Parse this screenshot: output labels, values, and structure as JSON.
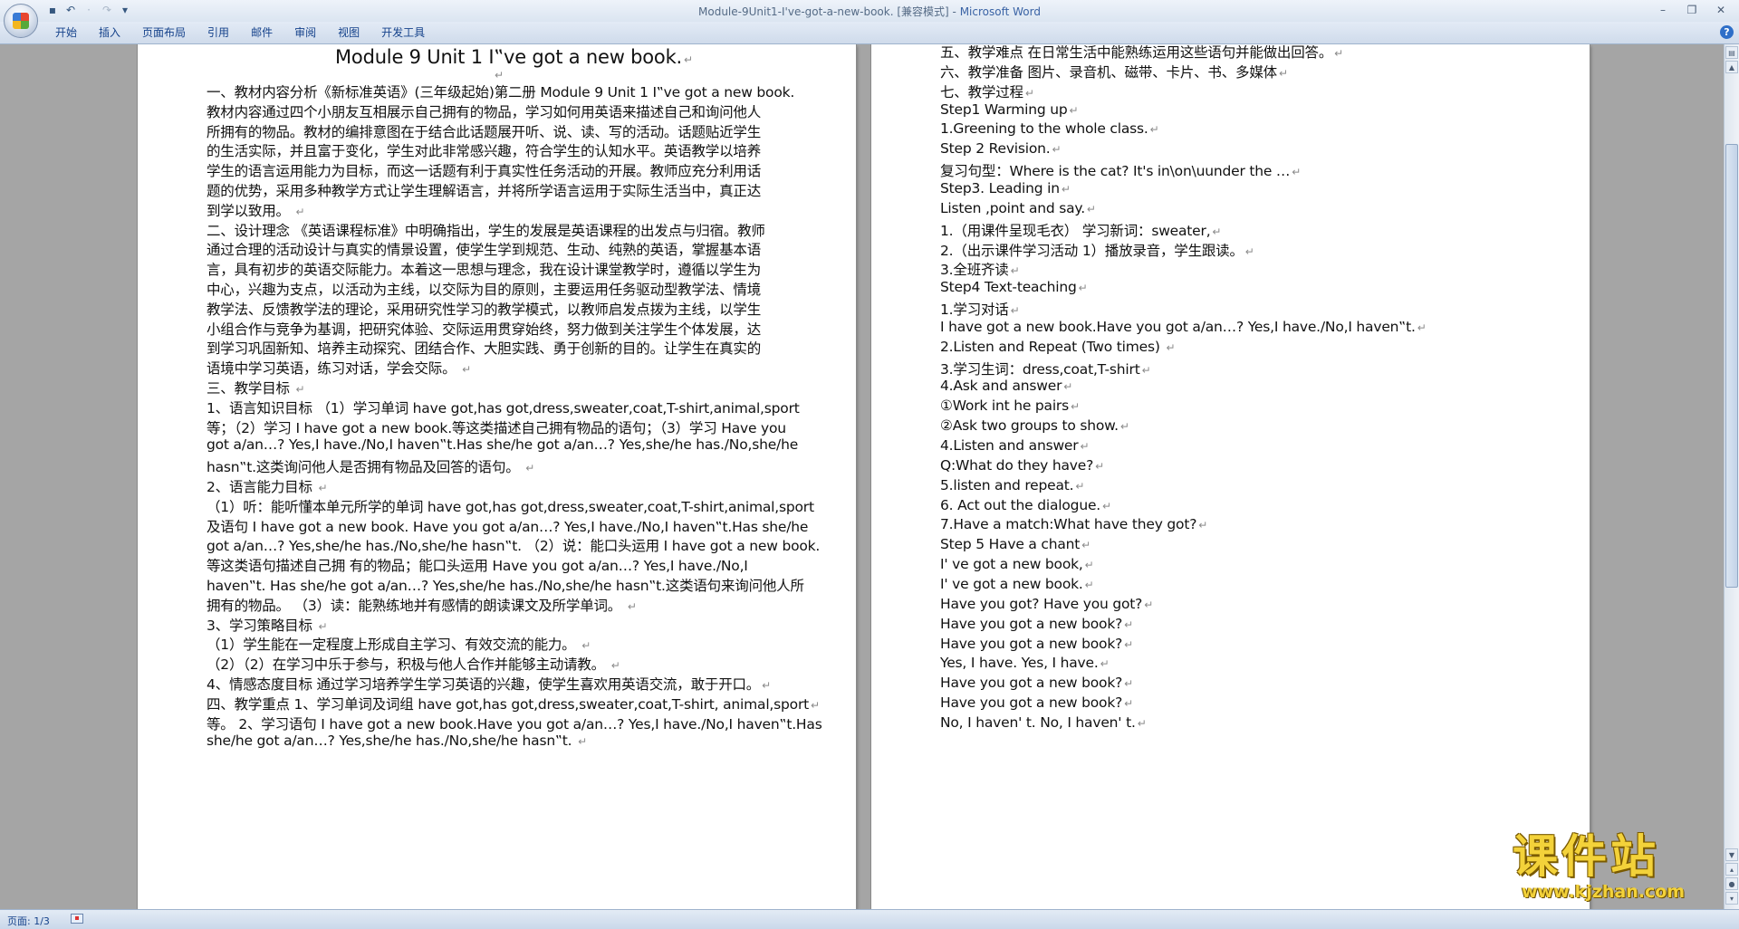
{
  "window": {
    "title": "Module-9Unit1-I've-got-a-new-book. [兼容模式] - ",
    "app": "Microsoft Word"
  },
  "quick_access": [
    {
      "name": "save-icon",
      "glyph": "▪"
    },
    {
      "name": "undo-icon",
      "glyph": "↶"
    },
    {
      "name": "undo-dropdown-icon",
      "glyph": "·"
    },
    {
      "name": "redo-icon",
      "glyph": "↷"
    },
    {
      "name": "customize-icon",
      "glyph": "▾"
    }
  ],
  "ribbon": {
    "tabs": [
      "开始",
      "插入",
      "页面布局",
      "引用",
      "邮件",
      "审阅",
      "视图",
      "开发工具"
    ]
  },
  "page1": {
    "lines": [
      "Module 9  Unit 1 I‟ve got a new book.",
      "",
      "一、教材内容分析《新标准英语》(三年级起始)第二册 Module 9  Unit 1 I‟ve got a new book.",
      "教材内容通过四个小朋友互相展示自己拥有的物品，学习如何用英语来描述自己和询问他人",
      "所拥有的物品。教材的编排意图在于结合此话题展开听、说、读、写的活动。话题贴近学生",
      "的生活实际，并且富于变化，学生对此非常感兴趣，符合学生的认知水平。英语教学以培养",
      "学生的语言运用能力为目标，而这一话题有利于真实性任务活动的开展。教师应充分利用话",
      "题的优势，采用多种教学方式让学生理解语言，并将所学语言运用于实际生活当中，真正达",
      "到学以致用。 ",
      "二、设计理念 《英语课程标准》中明确指出，学生的发展是英语课程的出发点与归宿。教师",
      "通过合理的活动设计与真实的情景设置，使学生学到规范、生动、纯熟的英语，掌握基本语",
      "言，具有初步的英语交际能力。本着这一思想与理念，我在设计课堂教学时，遵循以学生为",
      "中心，兴趣为支点，以活动为主线，以交际为目的原则，主要运用任务驱动型教学法、情境",
      "教学法、反馈教学法的理论，采用研究性学习的教学模式，以教师启发点拨为主线，以学生",
      "小组合作与竞争为基调，把研究体验、交际运用贯穿始终，努力做到关注学生个体发展，达",
      "到学习巩固新知、培养主动探究、团结合作、大胆实践、勇于创新的目的。让学生在真实的",
      "语境中学习英语，练习对话，学会交际。 ",
      "三、教学目标 ",
      "1、语言知识目标 （1）学习单词 have got,has got,dress,sweater,coat,T-shirt,animal,sport",
      "等；（2）学习 I have got a new book.等这类描述自己拥有物品的语句；（3）学习 Have you",
      "got a/an…? Yes,I have./No,I haven‟t.Has she/he got a/an…? Yes,she/he has./No,she/he",
      "hasn‟t.这类询问他人是否拥有物品及回答的语句。 ",
      "2、语言能力目标 ",
      "（1）听：能听懂本单元所学的单词 have got,has got,dress,sweater,coat,T-shirt,animal,sport",
      "及语句 I have got a new book. Have you got a/an…? Yes,I have./No,I haven‟t.Has she/he",
      "got a/an…? Yes,she/he has./No,she/he hasn‟t. （2）说：能口头运用 I have got a new book.",
      "等这类语句描述自己拥 有的物品；能口头运用 Have you got a/an…? Yes,I have./No,I",
      "haven‟t. Has she/he got a/an…? Yes,she/he has./No,she/he hasn‟t.这类语句来询问他人所",
      "拥有的物品。 （3）读：能熟练地并有感情的朗读课文及所学单词。 ",
      " 3、学习策略目标 ",
      "（1）学生能在一定程度上形成自主学习、有效交流的能力。 ",
      "（2）（2）在学习中乐于参与，积极与他人合作并能够主动请教。 ",
      "4、情感态度目标 通过学习培养学生学习英语的兴趣，使学生喜欢用英语交流，敢于开口。",
      " 四、教学重点 1、学习单词及词组 have got,has got,dress,sweater,coat,T-shirt, animal,sport",
      "等。 2、学习语句 I have got a new book.Have you got a/an…? Yes,I have./No,I haven‟t.Has",
      "she/he got a/an…? Yes,she/he has./No,she/he hasn‟t. "
    ]
  },
  "page2": {
    "lines": [
      "五、教学难点 在日常生活中能熟练运用这些语句并能做出回答。",
      "六、教学准备 图片、录音机、磁带、卡片、书、多媒体",
      " 七、教学过程",
      " Step1 Warming up",
      "1.Greening to    the whole class.",
      "Step 2 Revision.",
      "复习句型：Where is the cat?      It's in\\on\\uunder  the …",
      " Step3. Leading in",
      "Listen ,point and say.",
      "1.（用课件呈现毛衣） 学习新词：sweater,",
      "2.（出示课件学习活动 1）播放录音，学生跟读。",
      "3.全班齐读",
      "Step4 Text-teaching",
      "1.学习对话",
      "I have got a new book.Have you got a/an…? Yes,I have./No,I haven‟t.",
      "2.Listen and Repeat (Two times) ",
      "3.学习生词：dress,coat,T-shirt",
      "4.Ask and answer",
      "①Work int he pairs",
      "②Ask two groups to show.",
      "4.Listen and answer",
      "Q:What do they have?",
      "5.listen and repeat.",
      "6.  Act out the dialogue.",
      "7.Have a match:What have they got?",
      "Step 5 Have a chant",
      " I' ve got a new book,",
      "I' ve got a new book.",
      "Have you got? Have you got?",
      "Have you got a new book?",
      "Have you got a new book?",
      "Yes, I have. Yes, I have.",
      "Have you got a new book?",
      "Have you got a new book?",
      "No, I haven' t. No, I haven' t."
    ]
  },
  "statusbar": {
    "page_indicator": "页面: 1/3"
  },
  "watermark": {
    "cn": "课件站",
    "url": "www.kjzhan.com"
  },
  "colors": {
    "workspace_bg": "#a5a5a5",
    "ribbon_text": "#15428b",
    "brand_blue": "#3a63a5",
    "watermark_yellow": "#f3d23a"
  }
}
